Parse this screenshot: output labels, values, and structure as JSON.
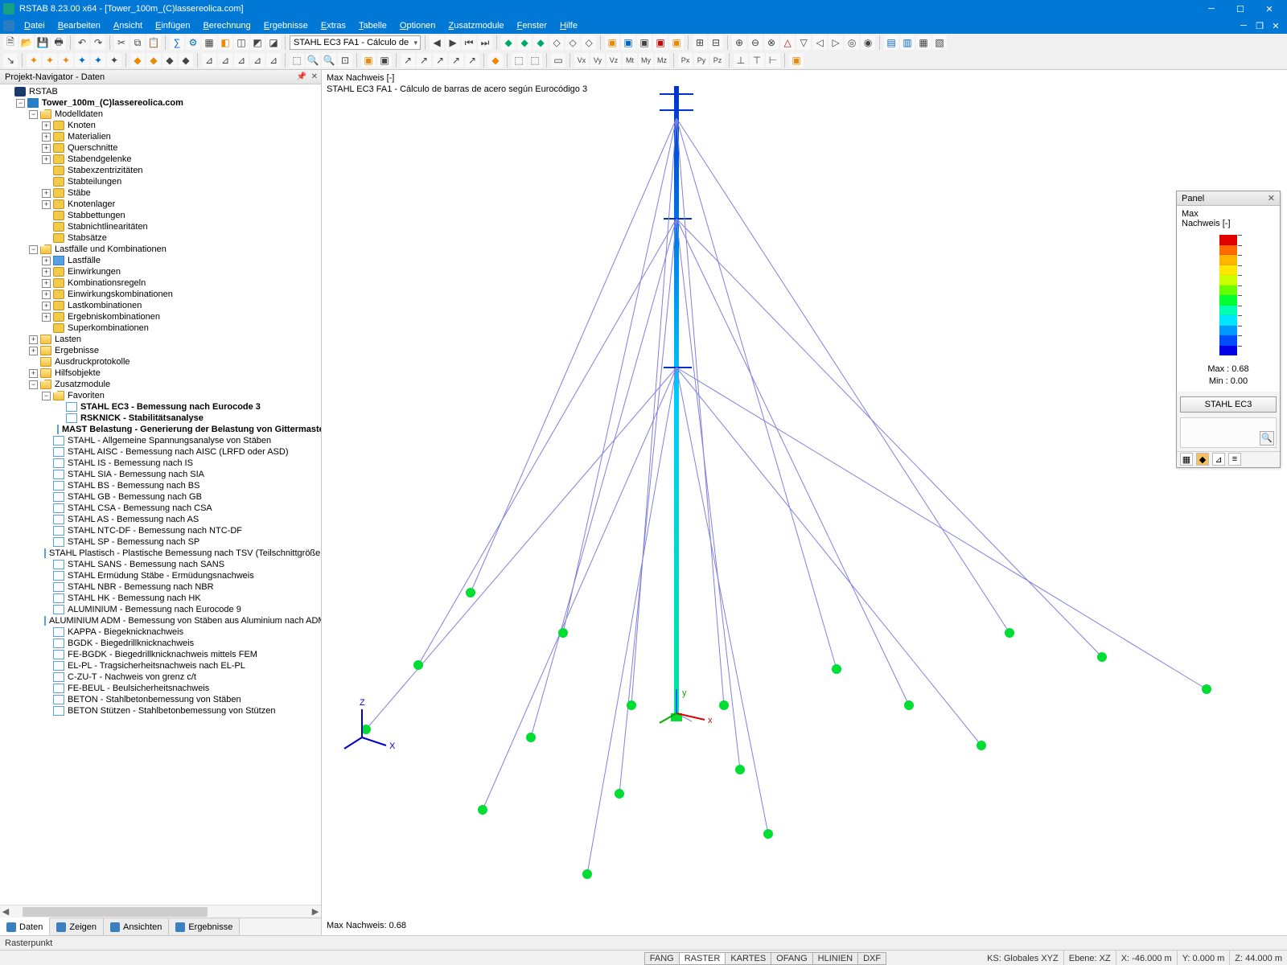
{
  "title": "RSTAB 8.23.00 x64 - [Tower_100m_(C)lassereolica.com]",
  "menu": [
    "Datei",
    "Bearbeiten",
    "Ansicht",
    "Einfügen",
    "Berechnung",
    "Ergebnisse",
    "Extras",
    "Tabelle",
    "Optionen",
    "Zusatzmodule",
    "Fenster",
    "Hilfe"
  ],
  "toolbar_combo": "STAHL EC3 FA1 - Cálculo de",
  "navigator": {
    "title": "Projekt-Navigator - Daten",
    "root": "RSTAB",
    "project": "Tower_100m_(C)lassereolica.com",
    "modelldaten": {
      "label": "Modelldaten",
      "items": [
        "Knoten",
        "Materialien",
        "Querschnitte",
        "Stabendgelenke",
        "Stabexzentrizitäten",
        "Stabteilungen",
        "Stäbe",
        "Knotenlager",
        "Stabbettungen",
        "Stabnichtlinearitäten",
        "Stabsätze"
      ]
    },
    "lastfaelle": {
      "label": "Lastfälle und Kombinationen",
      "items": [
        "Lastfälle",
        "Einwirkungen",
        "Kombinationsregeln",
        "Einwirkungskombinationen",
        "Lastkombinationen",
        "Ergebniskombinationen",
        "Superkombinationen"
      ]
    },
    "lasten": "Lasten",
    "ergebnisse": "Ergebnisse",
    "protokolle": "Ausdruckprotokolle",
    "hilfsobjekte": "Hilfsobjekte",
    "zusatzmodule": {
      "label": "Zusatzmodule",
      "favoriten": "Favoriten",
      "fav_items": [
        "STAHL EC3 - Bemessung nach Eurocode 3",
        "RSKNICK - Stabilitätsanalyse",
        "MAST Belastung - Generierung der Belastung von Gittermasten"
      ],
      "modules": [
        "STAHL - Allgemeine Spannungsanalyse von Stäben",
        "STAHL AISC - Bemessung nach AISC (LRFD oder ASD)",
        "STAHL IS - Bemessung nach IS",
        "STAHL SIA - Bemessung nach SIA",
        "STAHL BS - Bemessung nach BS",
        "STAHL GB - Bemessung nach GB",
        "STAHL CSA - Bemessung nach CSA",
        "STAHL AS - Bemessung nach AS",
        "STAHL NTC-DF - Bemessung nach NTC-DF",
        "STAHL SP - Bemessung nach SP",
        "STAHL Plastisch - Plastische Bemessung nach TSV (Teilschnittgrößenverfa",
        "STAHL SANS - Bemessung nach SANS",
        "STAHL Ermüdung Stäbe - Ermüdungsnachweis",
        "STAHL NBR - Bemessung nach NBR",
        "STAHL HK - Bemessung nach HK",
        "ALUMINIUM - Bemessung nach Eurocode 9",
        "ALUMINIUM ADM - Bemessung von Stäben aus Aluminium nach ADM",
        "KAPPA - Biegeknicknachweis",
        "BGDK - Biegedrillknicknachweis",
        "FE-BGDK - Biegedrillknicknachweis mittels FEM",
        "EL-PL - Tragsicherheitsnachweis nach EL-PL",
        "C-ZU-T - Nachweis von grenz c/t",
        "FE-BEUL - Beulsicherheitsnachweis",
        "BETON - Stahlbetonbemessung von Stäben",
        "BETON Stützen - Stahlbetonbemessung von Stützen"
      ]
    },
    "tabs": [
      "Daten",
      "Zeigen",
      "Ansichten",
      "Ergebnisse"
    ]
  },
  "viewport": {
    "line1": "Max Nachweis [-]",
    "line2": "STAHL EC3 FA1 - Cálculo de barras de acero según Eurocódigo 3",
    "bottom": "Max Nachweis: 0.68"
  },
  "panel": {
    "title": "Panel",
    "sub1": "Max",
    "sub2": "Nachweis [-]",
    "max": "Max  :  0.68",
    "min": "Min   :  0.00",
    "button": "STAHL EC3",
    "legend_colors": [
      "#e10000",
      "#ff6a00",
      "#ffb400",
      "#ffe600",
      "#ccff00",
      "#66ff00",
      "#00ff33",
      "#00ffb3",
      "#00e6ff",
      "#0099ff",
      "#004cff",
      "#0000e6"
    ]
  },
  "status": {
    "left": "Rasterpunkt",
    "tabs": [
      "FANG",
      "RASTER",
      "KARTES",
      "OFANG",
      "HLINIEN",
      "DXF"
    ],
    "ks": "KS: Globales XYZ",
    "ebene": "Ebene: XZ",
    "x": "X: -46.000 m",
    "y": "Y: 0.000 m",
    "z": "Z: 44.000 m"
  }
}
